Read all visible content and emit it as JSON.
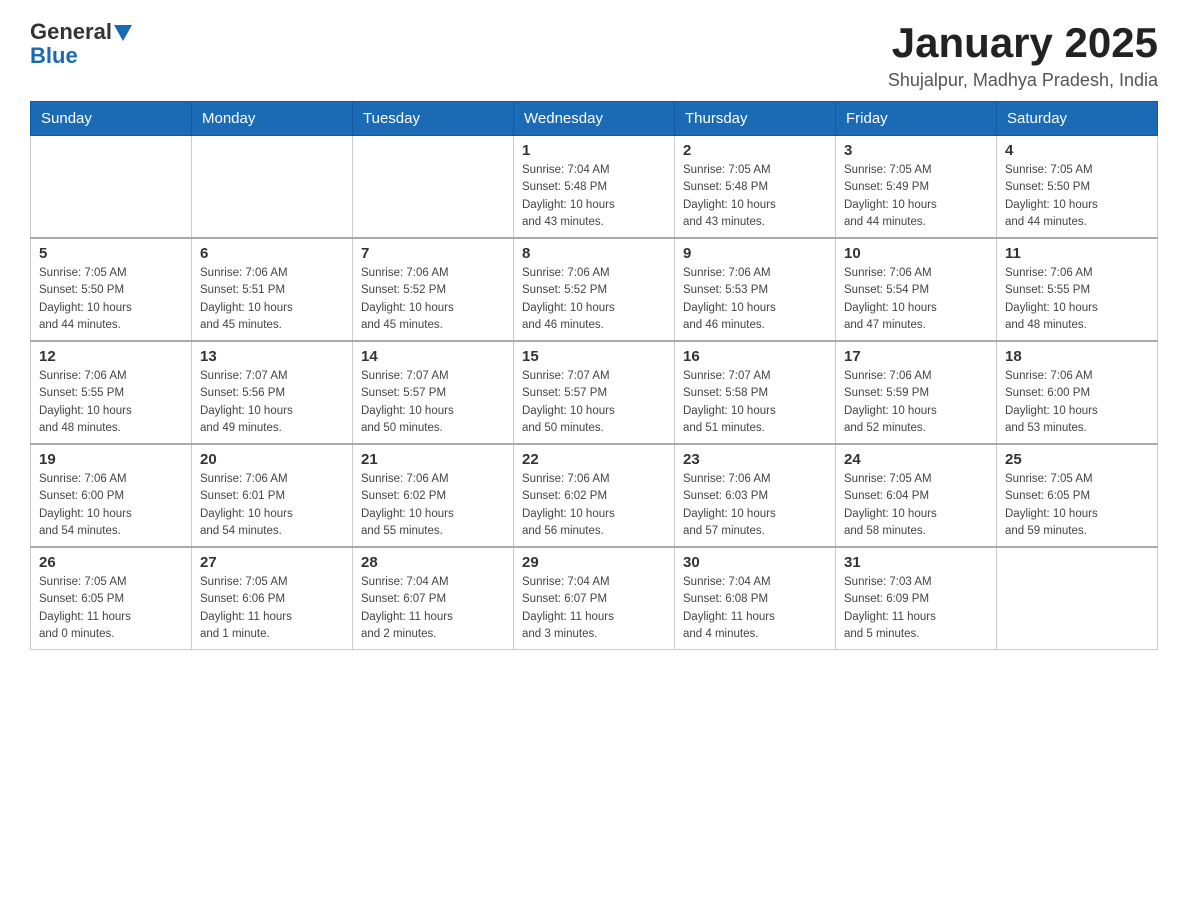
{
  "header": {
    "logo_general": "General",
    "logo_blue": "Blue",
    "title": "January 2025",
    "subtitle": "Shujalpur, Madhya Pradesh, India"
  },
  "days_of_week": [
    "Sunday",
    "Monday",
    "Tuesday",
    "Wednesday",
    "Thursday",
    "Friday",
    "Saturday"
  ],
  "weeks": [
    [
      {
        "day": "",
        "info": ""
      },
      {
        "day": "",
        "info": ""
      },
      {
        "day": "",
        "info": ""
      },
      {
        "day": "1",
        "info": "Sunrise: 7:04 AM\nSunset: 5:48 PM\nDaylight: 10 hours\nand 43 minutes."
      },
      {
        "day": "2",
        "info": "Sunrise: 7:05 AM\nSunset: 5:48 PM\nDaylight: 10 hours\nand 43 minutes."
      },
      {
        "day": "3",
        "info": "Sunrise: 7:05 AM\nSunset: 5:49 PM\nDaylight: 10 hours\nand 44 minutes."
      },
      {
        "day": "4",
        "info": "Sunrise: 7:05 AM\nSunset: 5:50 PM\nDaylight: 10 hours\nand 44 minutes."
      }
    ],
    [
      {
        "day": "5",
        "info": "Sunrise: 7:05 AM\nSunset: 5:50 PM\nDaylight: 10 hours\nand 44 minutes."
      },
      {
        "day": "6",
        "info": "Sunrise: 7:06 AM\nSunset: 5:51 PM\nDaylight: 10 hours\nand 45 minutes."
      },
      {
        "day": "7",
        "info": "Sunrise: 7:06 AM\nSunset: 5:52 PM\nDaylight: 10 hours\nand 45 minutes."
      },
      {
        "day": "8",
        "info": "Sunrise: 7:06 AM\nSunset: 5:52 PM\nDaylight: 10 hours\nand 46 minutes."
      },
      {
        "day": "9",
        "info": "Sunrise: 7:06 AM\nSunset: 5:53 PM\nDaylight: 10 hours\nand 46 minutes."
      },
      {
        "day": "10",
        "info": "Sunrise: 7:06 AM\nSunset: 5:54 PM\nDaylight: 10 hours\nand 47 minutes."
      },
      {
        "day": "11",
        "info": "Sunrise: 7:06 AM\nSunset: 5:55 PM\nDaylight: 10 hours\nand 48 minutes."
      }
    ],
    [
      {
        "day": "12",
        "info": "Sunrise: 7:06 AM\nSunset: 5:55 PM\nDaylight: 10 hours\nand 48 minutes."
      },
      {
        "day": "13",
        "info": "Sunrise: 7:07 AM\nSunset: 5:56 PM\nDaylight: 10 hours\nand 49 minutes."
      },
      {
        "day": "14",
        "info": "Sunrise: 7:07 AM\nSunset: 5:57 PM\nDaylight: 10 hours\nand 50 minutes."
      },
      {
        "day": "15",
        "info": "Sunrise: 7:07 AM\nSunset: 5:57 PM\nDaylight: 10 hours\nand 50 minutes."
      },
      {
        "day": "16",
        "info": "Sunrise: 7:07 AM\nSunset: 5:58 PM\nDaylight: 10 hours\nand 51 minutes."
      },
      {
        "day": "17",
        "info": "Sunrise: 7:06 AM\nSunset: 5:59 PM\nDaylight: 10 hours\nand 52 minutes."
      },
      {
        "day": "18",
        "info": "Sunrise: 7:06 AM\nSunset: 6:00 PM\nDaylight: 10 hours\nand 53 minutes."
      }
    ],
    [
      {
        "day": "19",
        "info": "Sunrise: 7:06 AM\nSunset: 6:00 PM\nDaylight: 10 hours\nand 54 minutes."
      },
      {
        "day": "20",
        "info": "Sunrise: 7:06 AM\nSunset: 6:01 PM\nDaylight: 10 hours\nand 54 minutes."
      },
      {
        "day": "21",
        "info": "Sunrise: 7:06 AM\nSunset: 6:02 PM\nDaylight: 10 hours\nand 55 minutes."
      },
      {
        "day": "22",
        "info": "Sunrise: 7:06 AM\nSunset: 6:02 PM\nDaylight: 10 hours\nand 56 minutes."
      },
      {
        "day": "23",
        "info": "Sunrise: 7:06 AM\nSunset: 6:03 PM\nDaylight: 10 hours\nand 57 minutes."
      },
      {
        "day": "24",
        "info": "Sunrise: 7:05 AM\nSunset: 6:04 PM\nDaylight: 10 hours\nand 58 minutes."
      },
      {
        "day": "25",
        "info": "Sunrise: 7:05 AM\nSunset: 6:05 PM\nDaylight: 10 hours\nand 59 minutes."
      }
    ],
    [
      {
        "day": "26",
        "info": "Sunrise: 7:05 AM\nSunset: 6:05 PM\nDaylight: 11 hours\nand 0 minutes."
      },
      {
        "day": "27",
        "info": "Sunrise: 7:05 AM\nSunset: 6:06 PM\nDaylight: 11 hours\nand 1 minute."
      },
      {
        "day": "28",
        "info": "Sunrise: 7:04 AM\nSunset: 6:07 PM\nDaylight: 11 hours\nand 2 minutes."
      },
      {
        "day": "29",
        "info": "Sunrise: 7:04 AM\nSunset: 6:07 PM\nDaylight: 11 hours\nand 3 minutes."
      },
      {
        "day": "30",
        "info": "Sunrise: 7:04 AM\nSunset: 6:08 PM\nDaylight: 11 hours\nand 4 minutes."
      },
      {
        "day": "31",
        "info": "Sunrise: 7:03 AM\nSunset: 6:09 PM\nDaylight: 11 hours\nand 5 minutes."
      },
      {
        "day": "",
        "info": ""
      }
    ]
  ]
}
